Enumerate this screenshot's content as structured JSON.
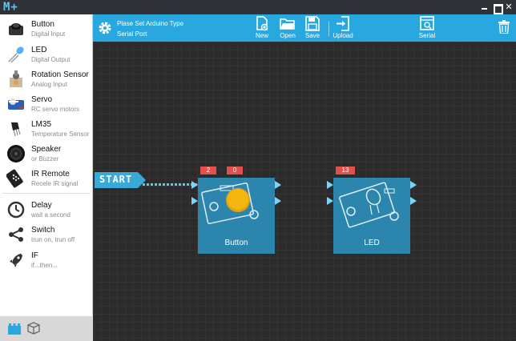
{
  "app": {
    "logo": "M+"
  },
  "sidebar": {
    "items": [
      {
        "name": "Button",
        "desc": "Digital Input",
        "icon": "button-icon"
      },
      {
        "name": "LED",
        "desc": "Digital Output",
        "icon": "led-icon"
      },
      {
        "name": "Rotation Sensor",
        "desc": "Analog Input",
        "icon": "rotation-sensor-icon"
      },
      {
        "name": "Servo",
        "desc": "RC servo motors",
        "icon": "servo-icon"
      },
      {
        "name": "LM35",
        "desc": "Temperature Sensor",
        "icon": "lm35-icon"
      },
      {
        "name": "Speaker",
        "desc": "or Buzzer",
        "icon": "speaker-icon"
      },
      {
        "name": "IR Remote",
        "desc": "Recele IR signal",
        "icon": "ir-remote-icon"
      },
      {
        "name": "Delay",
        "desc": "wait a second",
        "icon": "clock-icon"
      },
      {
        "name": "Switch",
        "desc": "trun on, trun off",
        "icon": "switch-icon"
      },
      {
        "name": "IF",
        "desc": "if...then...",
        "icon": "rocket-icon"
      }
    ]
  },
  "toolbar": {
    "arduino_type": "Plase Set Arduino Type",
    "serial_port": "Serial Port",
    "new_label": "New",
    "open_label": "Open",
    "save_label": "Save",
    "upload_label": "Upload",
    "serial_label": "Serial"
  },
  "canvas": {
    "start_label": "START",
    "modules": [
      {
        "name": "Button",
        "pins": [
          "2",
          "0"
        ]
      },
      {
        "name": "LED",
        "pins": [
          "13"
        ]
      }
    ]
  },
  "colors": {
    "toolbar": "#29a8e0",
    "canvas": "#2b2b2b",
    "module": "#2c85ad",
    "pin": "#e2504d",
    "port": "#7cd4f5"
  }
}
